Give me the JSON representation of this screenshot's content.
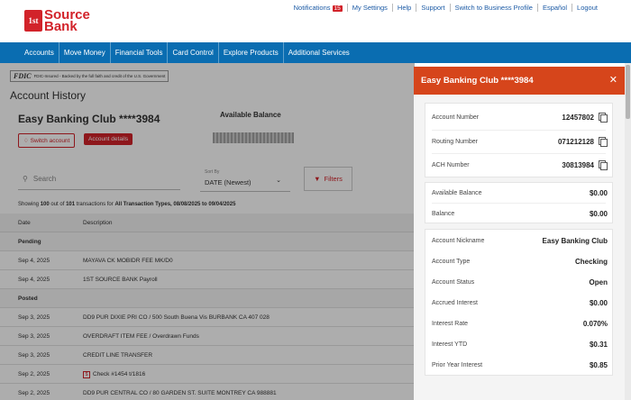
{
  "brand": {
    "logo_badge": "1st",
    "logo_line1": "Source",
    "logo_line2": "Bank",
    "color": "#d2232a"
  },
  "utility_links": [
    {
      "label": "Notifications",
      "badge": "15"
    },
    {
      "label": "My Settings"
    },
    {
      "label": "Help"
    },
    {
      "label": "Support"
    },
    {
      "label": "Switch to Business Profile"
    },
    {
      "label": "Español"
    },
    {
      "label": "Logout"
    }
  ],
  "nav": [
    "Accounts",
    "Move Money",
    "Financial Tools",
    "Card Control",
    "Explore Products",
    "Additional Services"
  ],
  "fdic": {
    "logo": "FDIC",
    "text": "FDIC-Insured - Backed by the full faith and credit of the U.S. Government"
  },
  "page": {
    "title": "Account History",
    "account_name": "Easy Banking Club ****3984",
    "available_balance_label": "Available Balance",
    "switch_account": "Switch account",
    "account_details": "Account details"
  },
  "controls": {
    "search_placeholder": "Search",
    "sort_label": "Sort By",
    "sort_value": "DATE (Newest)",
    "filters": "Filters"
  },
  "showing": {
    "prefix": "Showing",
    "count": "100",
    "middle": "out of",
    "total": "101",
    "after_total": "transactions for",
    "filter_desc": "All Transaction Types, 08/08/2025 to 09/04/2025"
  },
  "table": {
    "headers": [
      "Date",
      "Description"
    ],
    "groups": {
      "pending": "Pending",
      "posted": "Posted"
    },
    "pending_rows": [
      {
        "date": "Sep 4, 2025",
        "desc": "MAYAVA CK MOBIDR FEE MK/D0"
      },
      {
        "date": "Sep 4, 2025",
        "desc": "1ST SOURCE BANK Payroll"
      }
    ],
    "posted_rows": [
      {
        "date": "Sep 3, 2025",
        "desc": "DD9 PUR DIXIE PRI CO / 500 South Buena Vis BURBANK CA 407 028"
      },
      {
        "date": "Sep 3, 2025",
        "desc": "OVERDRAFT ITEM FEE / Overdrawn Funds"
      },
      {
        "date": "Sep 3, 2025",
        "desc": "CREDIT LINE TRANSFER"
      },
      {
        "date": "Sep 2, 2025",
        "desc": "Check #1454 t/1816"
      },
      {
        "date": "Sep 2, 2025",
        "desc": "DD9 PUR CENTRAL CO / 80 GARDEN ST. SUITE MONTREY CA 988881"
      }
    ]
  },
  "panel": {
    "title": "Easy Banking Club ****3984",
    "numbers": [
      {
        "label": "Account Number",
        "value": "12457802"
      },
      {
        "label": "Routing Number",
        "value": "071212128"
      },
      {
        "label": "ACH Number",
        "value": "30813984"
      }
    ],
    "balances": [
      {
        "label": "Available Balance",
        "value": "$0.00"
      },
      {
        "label": "Balance",
        "value": "$0.00"
      }
    ],
    "details": [
      {
        "label": "Account Nickname",
        "value": "Easy Banking Club"
      },
      {
        "label": "Account Type",
        "value": "Checking"
      },
      {
        "label": "Account Status",
        "value": "Open"
      },
      {
        "label": "Accrued Interest",
        "value": "$0.00"
      },
      {
        "label": "Interest Rate",
        "value": "0.070%"
      },
      {
        "label": "Interest YTD",
        "value": "$0.31"
      },
      {
        "label": "Prior Year Interest",
        "value": "$0.85"
      }
    ],
    "header_color": "#d6451b"
  }
}
